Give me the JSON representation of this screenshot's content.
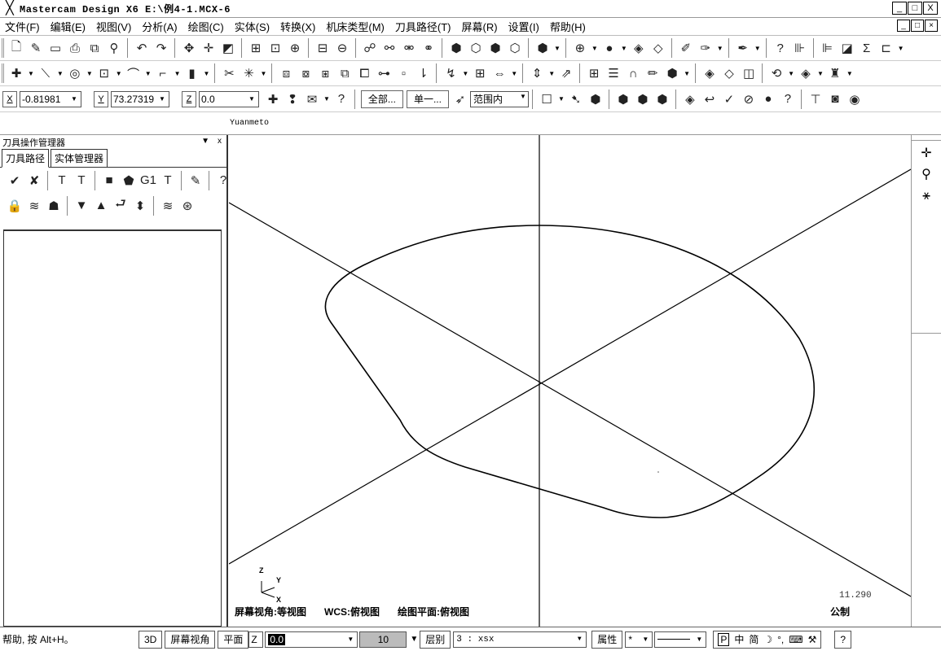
{
  "window": {
    "title": "Mastercam Design X6  E:\\例4-1.MCX-6",
    "minimize": "_",
    "restore": "□",
    "close": "X"
  },
  "menu": [
    "文件(F)",
    "编辑(E)",
    "视图(V)",
    "分析(A)",
    "绘图(C)",
    "实体(S)",
    "转换(X)",
    "机床类型(M)",
    "刀具路径(T)",
    "屏幕(R)",
    "设置(I)",
    "帮助(H)"
  ],
  "coords": {
    "x_label": "X",
    "x_value": "-0.81981",
    "y_label": "Y",
    "y_value": "73.27319",
    "z_label": "Z",
    "z_value": "0.0"
  },
  "selection": {
    "all_button": "全部...",
    "single_button": "单一...",
    "range_select": "范围内"
  },
  "strip_label": "Yuanmeto",
  "panel": {
    "title": "刀具操作管理器",
    "pin": "▼",
    "close": "x",
    "tabs": [
      "刀具路径",
      "实体管理器"
    ],
    "g1_label": "G1"
  },
  "viewport": {
    "screen_view": "屏幕视角:等视图",
    "wcs": "WCS:俯视图",
    "plane": "绘图平面:俯视图",
    "scale": "11.290",
    "units": "公制",
    "axis_z": "Z",
    "axis_y": "Y",
    "axis_x": "X"
  },
  "status": {
    "help": "帮助, 按 Alt+H。",
    "btn_3d": "3D",
    "screen_view": "屏幕视角",
    "plane": "平面",
    "z_label": "Z",
    "z_value": "0.0",
    "level_num": "10",
    "layer_label": "层别",
    "layer_value": "3 : xsx",
    "attr": "属性",
    "ime_p": "P",
    "ime_cn": "中",
    "ime_simp": "简",
    "help_q": "?"
  },
  "icons": {
    "app": "mastercam-logo-icon"
  }
}
